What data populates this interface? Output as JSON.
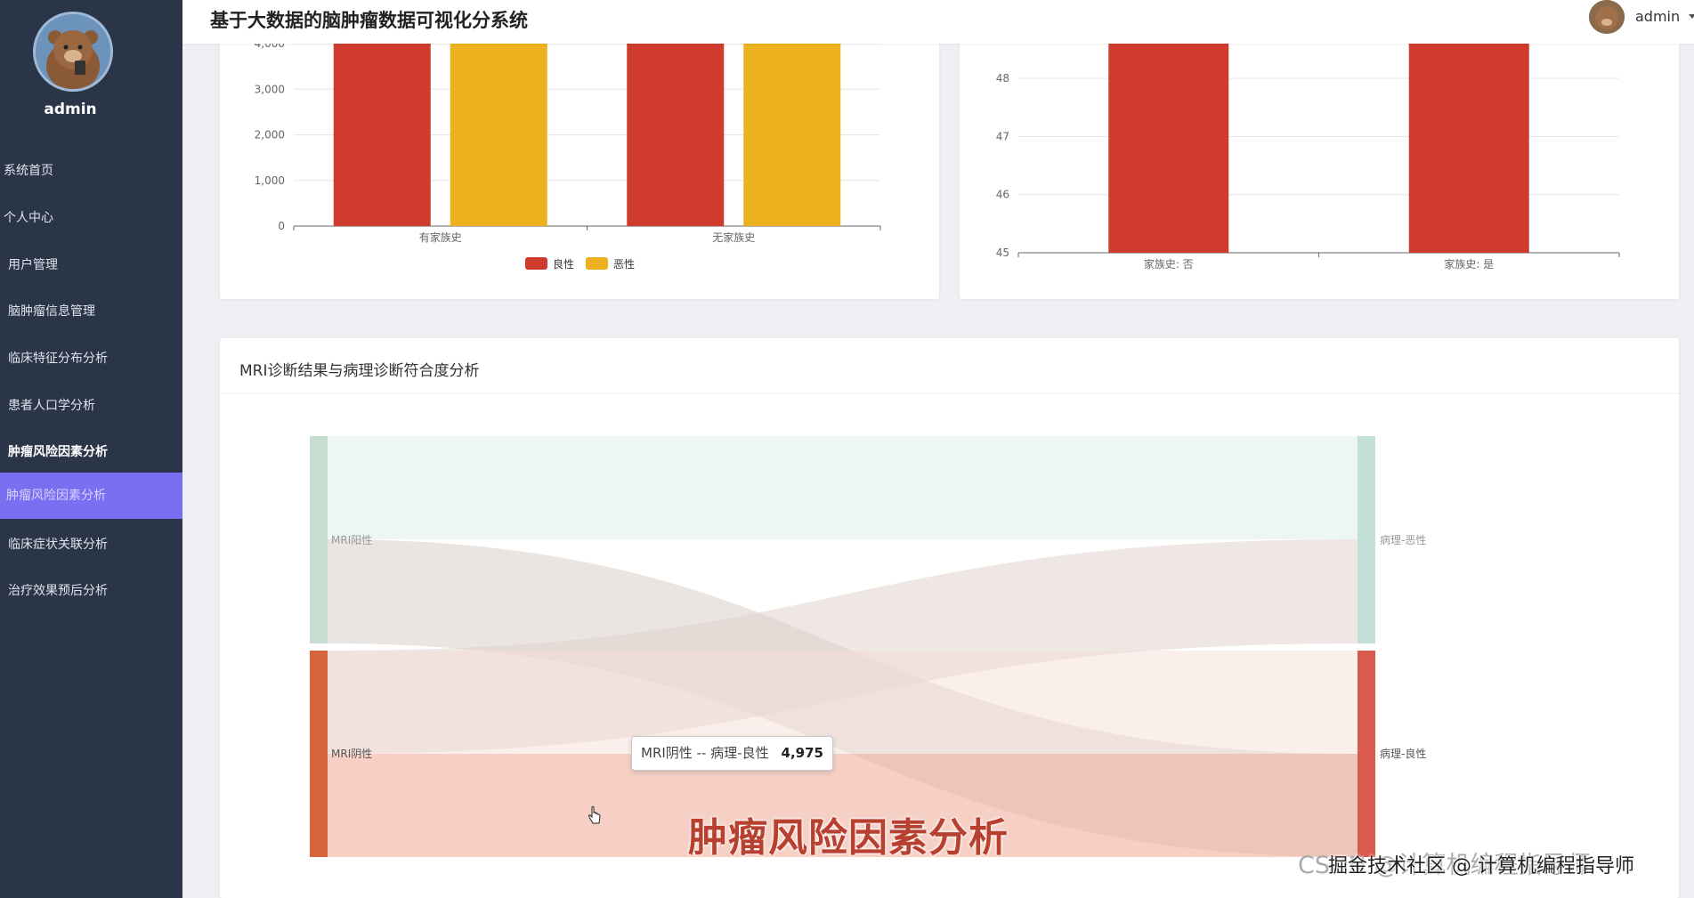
{
  "app": {
    "title": "基于大数据的脑肿瘤数据可视化分系统",
    "username": "admin"
  },
  "sidebar": {
    "username": "admin",
    "items": [
      {
        "label": "系统首页"
      },
      {
        "label": "个人中心"
      },
      {
        "label": "用户管理"
      },
      {
        "label": "脑肿瘤信息管理"
      },
      {
        "label": "临床特征分布分析"
      },
      {
        "label": "患者人口学分析"
      },
      {
        "label": "肿瘤风险因素分析"
      },
      {
        "label": "肿瘤风险因素分析"
      },
      {
        "label": "临床症状关联分析"
      },
      {
        "label": "治疗效果预后分析"
      }
    ],
    "active_index": 7
  },
  "colors": {
    "benign": "#cf3b2c",
    "malignant": "#ebb11e",
    "accent": "#7a6ff0",
    "sidebar_bg": "#2b3548"
  },
  "chart_data": [
    {
      "type": "bar",
      "categories": [
        "有家族史",
        "无家族史"
      ],
      "series": [
        {
          "name": "良性",
          "values": [
            4000,
            4000
          ]
        },
        {
          "name": "恶性",
          "values": [
            4000,
            4000
          ]
        }
      ],
      "yticks": [
        "0",
        "1,000",
        "2,000",
        "3,000",
        "4,000"
      ],
      "ylim": [
        0,
        4000
      ],
      "legend": "bottom-center",
      "grid": true
    },
    {
      "type": "bar",
      "categories": [
        "家族史: 否",
        "家族史: 是"
      ],
      "series": [
        {
          "values": [
            48.6,
            48.6
          ]
        }
      ],
      "yticks": [
        "45",
        "46",
        "47",
        "48"
      ],
      "ylim": [
        45,
        48.6
      ],
      "grid": true
    },
    {
      "type": "sankey",
      "title": "MRI诊断结果与病理诊断符合度分析",
      "nodes": [
        "MRI阳性",
        "MRI阴性",
        "病理-恶性",
        "病理-良性"
      ],
      "links": [
        {
          "source": "MRI阳性",
          "target": "病理-恶性"
        },
        {
          "source": "MRI阳性",
          "target": "病理-良性"
        },
        {
          "source": "MRI阴性",
          "target": "病理-恶性"
        },
        {
          "source": "MRI阴性",
          "target": "病理-良性",
          "value": 4975
        }
      ]
    }
  ],
  "tooltip": {
    "label": "MRI阴性 -- 病理-良性",
    "value": "4,975"
  },
  "overlay": {
    "watermark": "肿瘤风险因素分析",
    "credit": "CSDN @计算机编程指导师",
    "credit2": "掘金技术社区 @ 计算机编程指导师"
  }
}
